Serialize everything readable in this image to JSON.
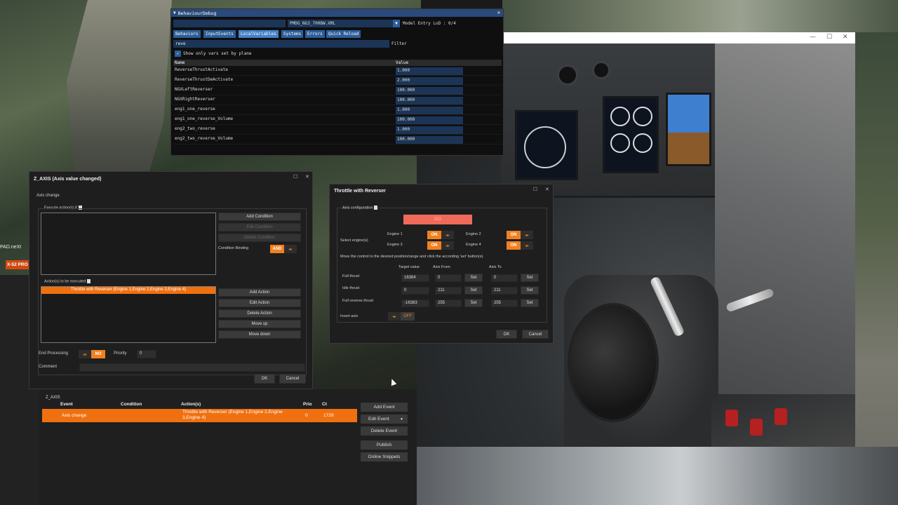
{
  "behaviour_debug": {
    "title": "BehaviourDebug",
    "aircraft_file": "PMDG_NG3_700BW.XML",
    "model_entry_lod": "Model Entry LoD : 0/4",
    "tabs": [
      "Behaviors",
      "InputEvents",
      "LocalVariables",
      "Systems",
      "Errors",
      "Quick Reload"
    ],
    "active_tab": "LocalVariables",
    "filter_value": "reve",
    "filter_label": "Filter",
    "show_only_label": "Show only vars set by plane",
    "columns": [
      "Name",
      "Value"
    ],
    "rows": [
      {
        "name": "ReverseThrustActivate",
        "value": "1.000"
      },
      {
        "name": "ReverseThrustDeActivate",
        "value": "2.000"
      },
      {
        "name": "NGXLeftReverser",
        "value": "100.000"
      },
      {
        "name": "NGXRightReverser",
        "value": "100.000"
      },
      {
        "name": "eng1_one_reverse",
        "value": "1.000"
      },
      {
        "name": "eng1_one_reverse_Volume",
        "value": "100.000"
      },
      {
        "name": "eng2_two_reverse",
        "value": "1.000"
      },
      {
        "name": "eng2_two_reverse_Volume",
        "value": "100.000"
      }
    ]
  },
  "z_axis_dialog": {
    "title": "Z_AXIS (Axis value changed)",
    "subtitle": "Axis change",
    "execute_if_label": "Execute action(s) if",
    "add_condition": "Add Condition",
    "edit_condition": "Edit Condition",
    "delete_condition": "Delete Condition",
    "condition_binding_label": "Condition Binding",
    "condition_binding_value": "AND",
    "actions_label": "Action(s) to be executed",
    "action_item": "Throttle with Reverser (Engine 1,Engine 2,Engine 3,Engine 4)",
    "add_action": "Add Action",
    "edit_action": "Edit Action",
    "delete_action": "Delete Action",
    "move_up": "Move up",
    "move_down": "Move down",
    "end_processing_label": "End Processing",
    "end_processing_value": "NO",
    "priority_label": "Priority",
    "priority_value": "0",
    "comment_label": "Comment",
    "ok": "OK",
    "cancel": "Cancel"
  },
  "throttle_dialog": {
    "title": "Throttle with Reverser",
    "axis_config_label": "Axis configuration",
    "axis_value": "322",
    "select_engines_label": "Select engine(s)",
    "engines": [
      {
        "label": "Engine 1",
        "state": "ON"
      },
      {
        "label": "Engine 2",
        "state": "ON"
      },
      {
        "label": "Engine 3",
        "state": "ON"
      },
      {
        "label": "Engine 4",
        "state": "ON"
      }
    ],
    "instruction": "Move the control to the desired position/range and click the according 'set' button(s).",
    "col_target": "Target value",
    "col_from": "Axis From",
    "col_to": "Axis To",
    "set_label": "Set",
    "rows": [
      {
        "label": "Full thrust",
        "target": "16384",
        "from": "0",
        "to": "0"
      },
      {
        "label": "Idle thrust",
        "target": "0",
        "from": "211",
        "to": "211"
      },
      {
        "label": "Full reverse thrust",
        "target": "-16383",
        "from": "255",
        "to": "255"
      }
    ],
    "invert_axis_label": "Invert axis",
    "invert_axis_value": "OFF",
    "ok": "OK",
    "cancel": "Cancel"
  },
  "background_app": {
    "pad_label": "PAD.neXt",
    "device_label": "X-52 PRO",
    "setting_label": "SETTI"
  },
  "events": {
    "axis_label": "Z_AXIS",
    "columns": {
      "event": "Event",
      "condition": "Condition",
      "actions": "Action(s)",
      "prio": "Prio",
      "ct": "Ct"
    },
    "rows": [
      {
        "event": "Axis change",
        "condition": "",
        "actions": "Throttle with Reverser (Engine 1,Engine 2,Engine 3,Engine 4)",
        "prio": "0",
        "ct": "1729"
      }
    ],
    "buttons": {
      "add": "Add Event",
      "edit": "Edit Event",
      "delete": "Delete Event",
      "publish": "Publish",
      "snippets": "Online Snippets"
    }
  },
  "colors": {
    "accent_orange": "#f08020",
    "axis_bar": "#f06a5a",
    "debug_blue": "#2d5e9a"
  }
}
